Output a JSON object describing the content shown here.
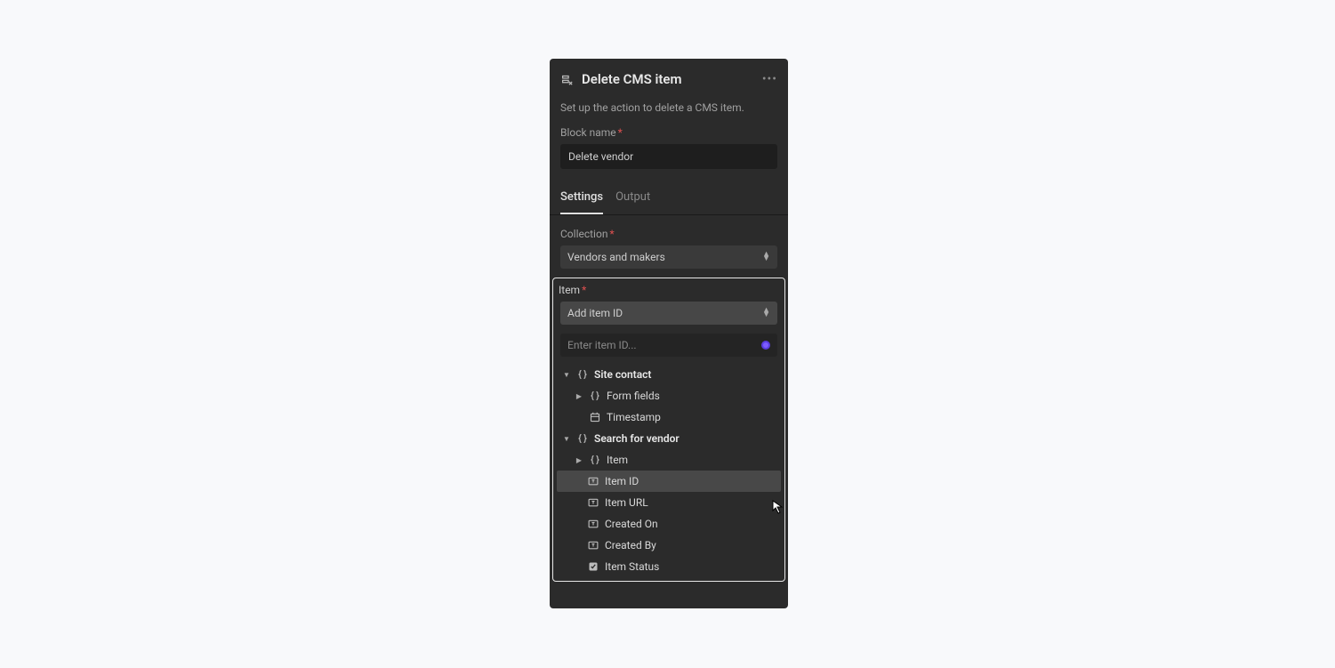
{
  "header": {
    "title": "Delete CMS item",
    "description": "Set up the action to delete a CMS item."
  },
  "block_name": {
    "label": "Block name",
    "value": "Delete vendor"
  },
  "tabs": {
    "settings": "Settings",
    "output": "Output"
  },
  "collection": {
    "label": "Collection",
    "value": "Vendors and makers"
  },
  "item": {
    "label": "Item",
    "select_placeholder": "Add item ID",
    "search_placeholder": "Enter item ID..."
  },
  "tree": {
    "site_contact": "Site contact",
    "form_fields": "Form fields",
    "timestamp": "Timestamp",
    "search_for_vendor": "Search for vendor",
    "item": "Item",
    "item_id": "Item ID",
    "item_url": "Item URL",
    "created_on": "Created On",
    "created_by": "Created By",
    "item_status": "Item Status"
  }
}
